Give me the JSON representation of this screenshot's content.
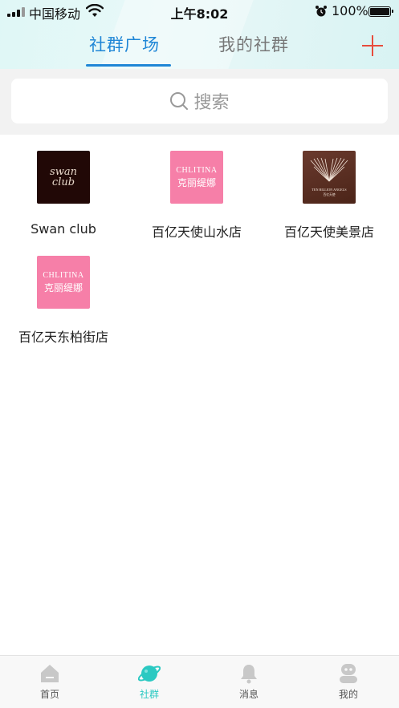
{
  "status_bar": {
    "carrier": "中国移动",
    "time": "上午8:02",
    "battery": "100%"
  },
  "tabs": [
    {
      "label": "社群广场",
      "active": true
    },
    {
      "label": "我的社群",
      "active": false
    }
  ],
  "add_icon": "plus-icon",
  "search": {
    "placeholder": "搜索",
    "icon": "search-icon"
  },
  "communities": [
    {
      "name": "Swan club",
      "logo_text": "swan\nclub"
    },
    {
      "name": "百亿天使山水店",
      "logo_en": "CHLITINA",
      "logo_cn": "克丽缇娜"
    },
    {
      "name": "百亿天使美景店",
      "logo_en": "TEN BILLION ANGELS",
      "logo_cn": "百亿天使"
    },
    {
      "name": "百亿天东柏街店",
      "logo_en": "CHLITINA",
      "logo_cn": "克丽缇娜"
    }
  ],
  "bottom_nav": [
    {
      "label": "首页",
      "icon": "home-icon",
      "active": false
    },
    {
      "label": "社群",
      "icon": "planet-icon",
      "active": true
    },
    {
      "label": "消息",
      "icon": "bell-icon",
      "active": false
    },
    {
      "label": "我的",
      "icon": "profile-icon",
      "active": false
    }
  ],
  "colors": {
    "accent_blue": "#1f86d6",
    "accent_red": "#e74c3c",
    "nav_active": "#2bc9c2",
    "brand_pink": "#f67fa8"
  }
}
